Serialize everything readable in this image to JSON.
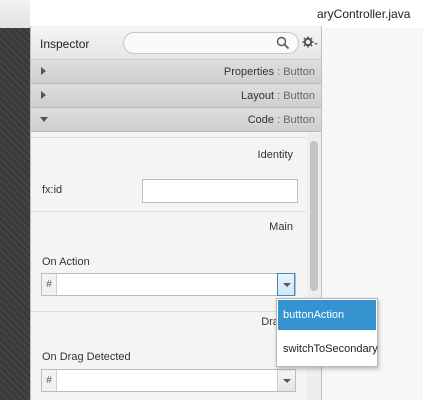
{
  "background_tab": {
    "title": "aryController.java"
  },
  "inspector": {
    "title": "Inspector",
    "search": {
      "value": "",
      "placeholder": ""
    }
  },
  "sections": [
    {
      "name": "Properties",
      "target": "Button",
      "expanded": false
    },
    {
      "name": "Layout",
      "target": "Button",
      "expanded": false
    },
    {
      "name": "Code",
      "target": "Button",
      "expanded": true
    }
  ],
  "code": {
    "identity_title": "Identity",
    "fxid_label": "fx:id",
    "fxid_value": "",
    "main_title": "Main",
    "on_action_label": "On Action",
    "hash": "#",
    "on_action_value": "",
    "dragdrop_title": "DragD",
    "on_drag_detected_label": "On Drag Detected",
    "on_drag_detected_value": ""
  },
  "dropdown": {
    "options": [
      "buttonAction",
      "switchToSecondary"
    ],
    "selected_index": 0
  },
  "colors": {
    "selection": "#3594d0",
    "accent_border": "#3d8cc6"
  }
}
